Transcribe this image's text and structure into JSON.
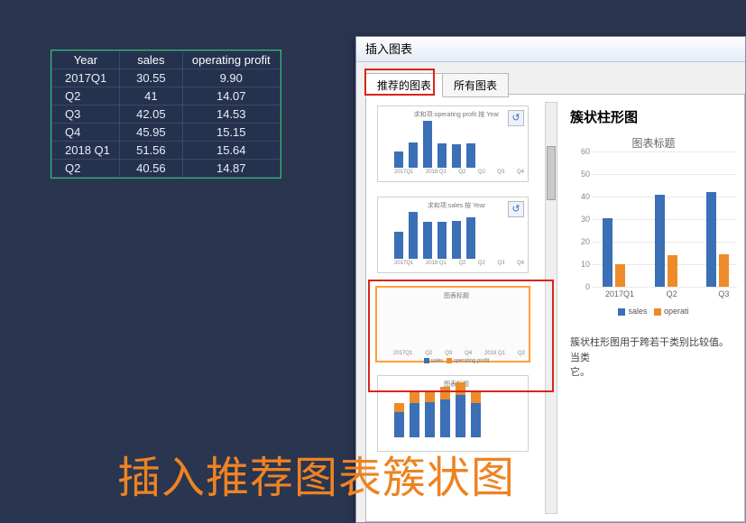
{
  "table": {
    "headers": [
      "Year",
      "sales",
      "operating profit"
    ],
    "rows": [
      {
        "year": "2017Q1",
        "sales": "30.55",
        "profit": "9.90"
      },
      {
        "year": "Q2",
        "sales": "41",
        "profit": "14.07"
      },
      {
        "year": "Q3",
        "sales": "42.05",
        "profit": "14.53"
      },
      {
        "year": "Q4",
        "sales": "45.95",
        "profit": "15.15"
      },
      {
        "year": "2018 Q1",
        "sales": "51.56",
        "profit": "15.64"
      },
      {
        "year": "Q2",
        "sales": "40.56",
        "profit": "14.87"
      }
    ]
  },
  "dialog": {
    "title": "插入图表",
    "tabs": {
      "recommended": "推荐的图表",
      "all": "所有图表"
    },
    "thumbs": {
      "t1_title": "求和项:operating profit   按 Year",
      "t2_title": "求和项:sales   按 Year",
      "t3_title": "图表标题",
      "t3_legend_sales": "sales",
      "t3_legend_profit": "operating profit",
      "categories": [
        "2017Q1",
        "2018 Q1",
        "Q2",
        "Q2",
        "Q3",
        "Q4"
      ]
    },
    "detail": {
      "chart_type": "簇状柱形图",
      "chart_title": "图表标题",
      "yticks": [
        "60",
        "50",
        "40",
        "30",
        "20",
        "10",
        "0"
      ],
      "categories": [
        "2017Q1",
        "Q2",
        "Q3"
      ],
      "legend_sales": "sales",
      "legend_profit": "operati",
      "description": "簇状柱形图用于跨若干类别比较值。当类",
      "description2": "它。"
    }
  },
  "caption": "插入推荐图表簇状图",
  "chart_data": {
    "type": "bar",
    "title": "图表标题",
    "chart_name": "簇状柱形图",
    "categories": [
      "2017Q1",
      "Q2",
      "Q3",
      "Q4",
      "2018 Q1",
      "Q2"
    ],
    "series": [
      {
        "name": "sales",
        "values": [
          30.55,
          41,
          42.05,
          45.95,
          51.56,
          40.56
        ],
        "color": "#3b6fb6"
      },
      {
        "name": "operating profit",
        "values": [
          9.9,
          14.07,
          14.53,
          15.15,
          15.64,
          14.87
        ],
        "color": "#ed8b2b"
      }
    ],
    "ylim": [
      0,
      60
    ],
    "thumbnails": [
      {
        "type": "bar",
        "title": "求和项:operating profit 按 Year",
        "series": "operating profit"
      },
      {
        "type": "bar",
        "title": "求和项:sales 按 Year",
        "series": "sales"
      },
      {
        "type": "bar",
        "title": "图表标题",
        "series": [
          "sales",
          "operating profit"
        ],
        "selected": true
      },
      {
        "type": "stacked-bar",
        "title": "图表标题",
        "series": [
          "sales",
          "operating profit"
        ]
      }
    ]
  }
}
